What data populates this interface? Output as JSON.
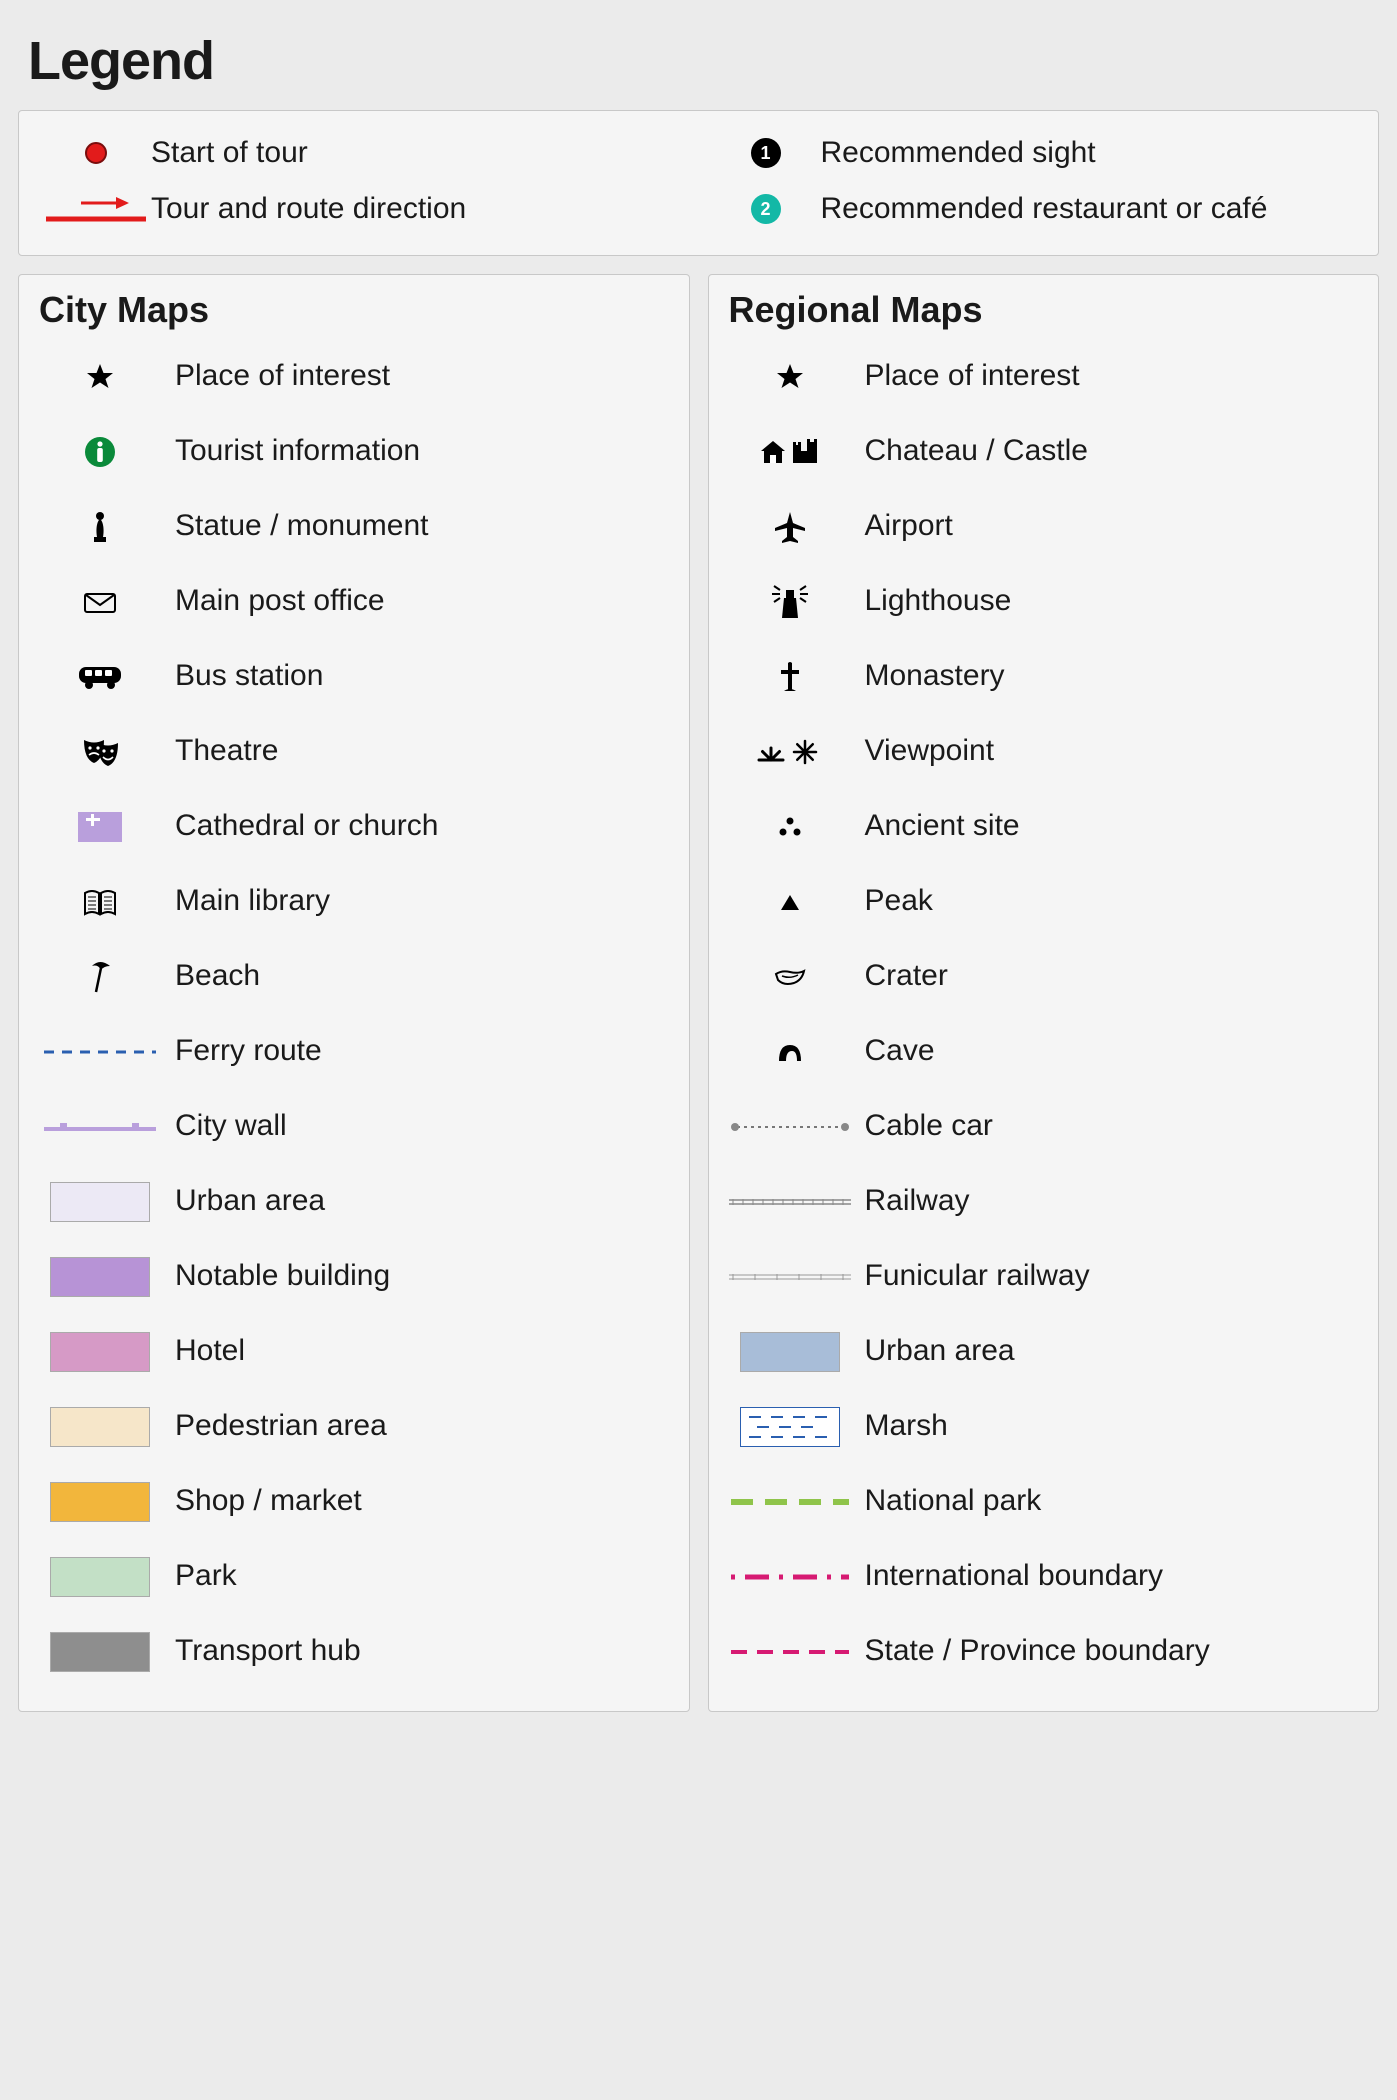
{
  "title": "Legend",
  "top": {
    "left": [
      {
        "icon": "start-dot",
        "label": "Start of tour"
      },
      {
        "icon": "route-arrow",
        "label": "Tour and route direction"
      }
    ],
    "right": [
      {
        "icon": "num-badge-black",
        "num": "1",
        "label": "Recommended sight"
      },
      {
        "icon": "num-badge-teal",
        "num": "2",
        "label": "Recommended restaurant or café"
      }
    ]
  },
  "city": {
    "heading": "City Maps",
    "items": [
      {
        "icon": "star",
        "label": "Place of interest"
      },
      {
        "icon": "info",
        "label": "Tourist information"
      },
      {
        "icon": "statue",
        "label": "Statue / monument"
      },
      {
        "icon": "post",
        "label": "Main post office"
      },
      {
        "icon": "bus",
        "label": "Bus station"
      },
      {
        "icon": "theatre",
        "label": "Theatre"
      },
      {
        "icon": "church",
        "label": "Cathedral or church"
      },
      {
        "icon": "library",
        "label": "Main library"
      },
      {
        "icon": "beach",
        "label": "Beach"
      },
      {
        "icon": "ferry-line",
        "label": "Ferry route"
      },
      {
        "icon": "city-wall-line",
        "label": "City wall"
      },
      {
        "icon": "swatch",
        "color": "#ece9f5",
        "label": "Urban area"
      },
      {
        "icon": "swatch",
        "color": "#b793d6",
        "label": "Notable building"
      },
      {
        "icon": "swatch",
        "color": "#d69ac6",
        "label": "Hotel"
      },
      {
        "icon": "swatch",
        "color": "#f6e6c9",
        "label": "Pedestrian area"
      },
      {
        "icon": "swatch",
        "color": "#f2b63c",
        "label": "Shop / market"
      },
      {
        "icon": "swatch",
        "color": "#c3e0c6",
        "label": "Park"
      },
      {
        "icon": "swatch",
        "color": "#8e8e8e",
        "label": "Transport hub"
      }
    ]
  },
  "regional": {
    "heading": "Regional Maps",
    "items": [
      {
        "icon": "star",
        "label": "Place of interest"
      },
      {
        "icon": "castle",
        "label": "Chateau / Castle"
      },
      {
        "icon": "airport",
        "label": "Airport"
      },
      {
        "icon": "lighthouse",
        "label": "Lighthouse"
      },
      {
        "icon": "monastery",
        "label": "Monastery"
      },
      {
        "icon": "viewpoint",
        "label": "Viewpoint"
      },
      {
        "icon": "ancient",
        "label": "Ancient site"
      },
      {
        "icon": "peak",
        "label": "Peak"
      },
      {
        "icon": "crater",
        "label": "Crater"
      },
      {
        "icon": "cave",
        "label": "Cave"
      },
      {
        "icon": "cable-car-line",
        "label": "Cable car"
      },
      {
        "icon": "railway-line",
        "label": "Railway"
      },
      {
        "icon": "funicular-line",
        "label": "Funicular railway"
      },
      {
        "icon": "swatch",
        "color": "#a8bdd8",
        "label": "Urban area"
      },
      {
        "icon": "marsh-swatch",
        "label": "Marsh"
      },
      {
        "icon": "natpark-line",
        "label": "National park"
      },
      {
        "icon": "intl-boundary",
        "label": "International boundary"
      },
      {
        "icon": "state-boundary",
        "label": "State / Province boundary"
      }
    ]
  }
}
